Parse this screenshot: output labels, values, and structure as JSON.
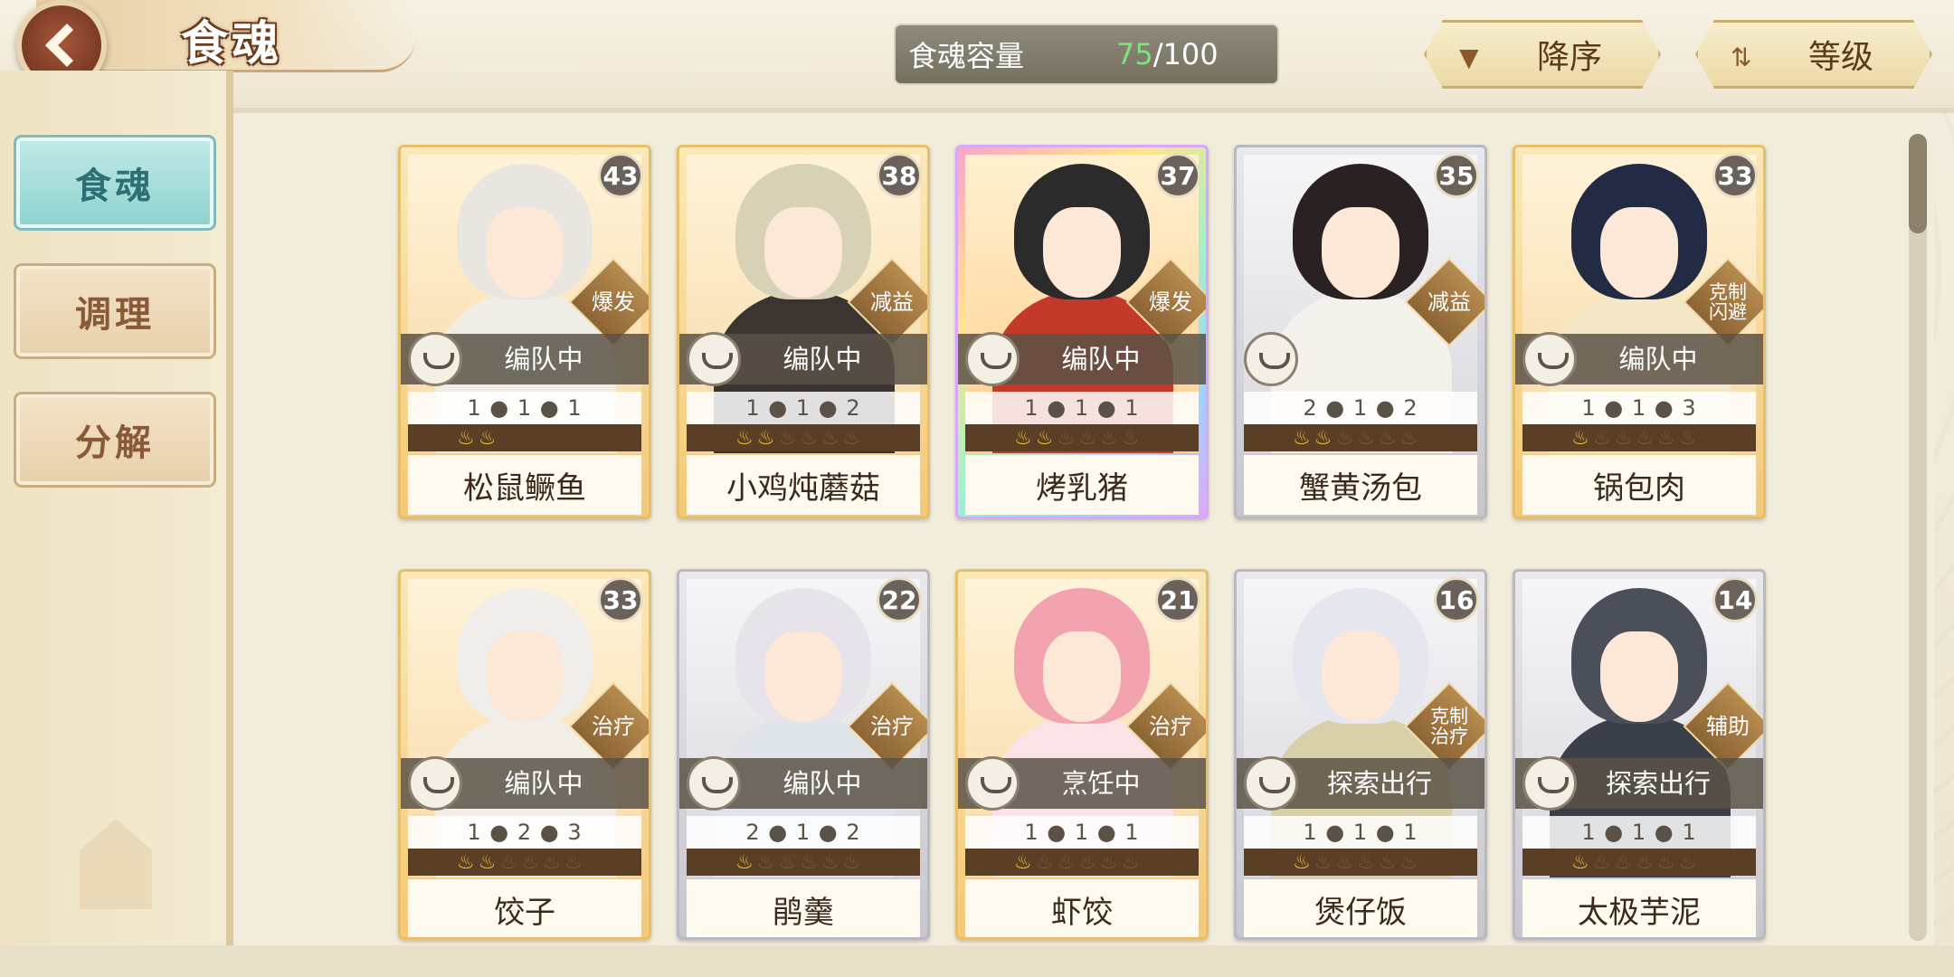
{
  "header": {
    "title": "食魂",
    "capacity_label": "食魂容量",
    "capacity_current": "75",
    "capacity_sep": "/",
    "capacity_max": "100",
    "sort_order_label": "降序",
    "sort_field_label": "等级",
    "sort_order_icon": "triangle-down-icon",
    "sort_field_icon": "swap-icon"
  },
  "sidebar": {
    "items": [
      {
        "label": "食魂",
        "active": true
      },
      {
        "label": "调理",
        "active": false
      },
      {
        "label": "分解",
        "active": false
      }
    ]
  },
  "cards": [
    {
      "name": "松鼠鳜鱼",
      "level": "43",
      "role": "爆发",
      "status": "编队中",
      "stats": "1 ● 1 ● 1",
      "flames_on": 2,
      "flames_total": 2,
      "frame": "gold",
      "hair": "#e9e6e2",
      "body": "#f0ede6"
    },
    {
      "name": "小鸡炖蘑菇",
      "level": "38",
      "role": "减益",
      "status": "编队中",
      "stats": "1 ● 1 ● 2",
      "flames_on": 2,
      "flames_total": 6,
      "frame": "gold",
      "hair": "#d7d2b6",
      "body": "#3b3430"
    },
    {
      "name": "烤乳猪",
      "level": "37",
      "role": "爆发",
      "status": "编队中",
      "stats": "1 ● 1 ● 1",
      "flames_on": 2,
      "flames_total": 6,
      "frame": "rainbow",
      "hair": "#2b2b2b",
      "body": "#c33a2a"
    },
    {
      "name": "蟹黄汤包",
      "level": "35",
      "role": "减益",
      "status": "",
      "stats": "2 ● 1 ● 2",
      "flames_on": 2,
      "flames_total": 6,
      "frame": "silver",
      "hair": "#2a2222",
      "body": "#f4f1ec"
    },
    {
      "name": "锅包肉",
      "level": "33",
      "role": "克制\n闪避",
      "status": "编队中",
      "stats": "1 ● 1 ● 3",
      "flames_on": 1,
      "flames_total": 6,
      "frame": "gold",
      "hair": "#232a44",
      "body": "#f3e7c8"
    },
    {
      "name": "饺子",
      "level": "33",
      "role": "治疗",
      "status": "编队中",
      "stats": "1 ● 2 ● 3",
      "flames_on": 2,
      "flames_total": 6,
      "frame": "gold",
      "hair": "#efeeea",
      "body": "#f2eee6"
    },
    {
      "name": "鹃羹",
      "level": "22",
      "role": "治疗",
      "status": "编队中",
      "stats": "2 ● 1 ● 2",
      "flames_on": 1,
      "flames_total": 6,
      "frame": "silver",
      "hair": "#e6e4ea",
      "body": "#dfe3ea"
    },
    {
      "name": "虾饺",
      "level": "21",
      "role": "治疗",
      "status": "烹饪中",
      "stats": "1 ● 1 ● 1",
      "flames_on": 1,
      "flames_total": 6,
      "frame": "gold",
      "hair": "#f3a2b0",
      "body": "#fbe2e6"
    },
    {
      "name": "煲仔饭",
      "level": "16",
      "role": "克制\n治疗",
      "status": "探索出行",
      "stats": "1 ● 1 ● 1",
      "flames_on": 1,
      "flames_total": 6,
      "frame": "silver",
      "hair": "#e6e6ef",
      "body": "#d9cfa9"
    },
    {
      "name": "太极芋泥",
      "level": "14",
      "role": "辅助",
      "status": "探索出行",
      "stats": "1 ● 1 ● 1",
      "flames_on": 1,
      "flames_total": 6,
      "frame": "silver",
      "hair": "#4a4f5a",
      "body": "#3b3f4a"
    }
  ]
}
